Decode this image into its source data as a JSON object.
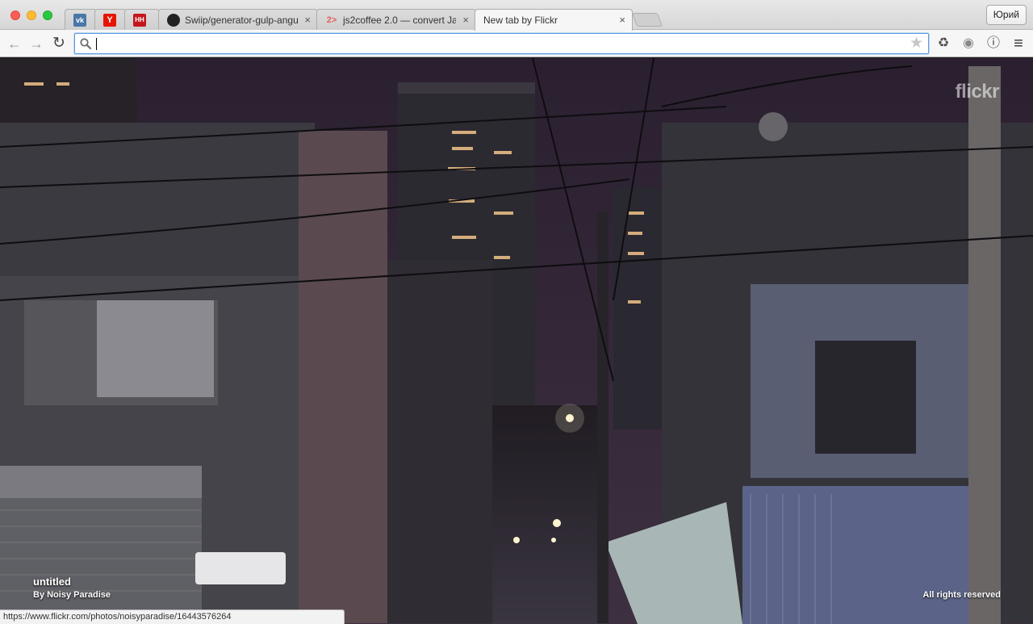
{
  "window": {
    "tabs": [
      {
        "favicon": "vk-icon",
        "favicon_text": "vk",
        "title": ""
      },
      {
        "favicon": "yandex-icon",
        "favicon_text": "Y",
        "title": ""
      },
      {
        "favicon": "habr-icon",
        "favicon_text": "HH",
        "title": ""
      },
      {
        "favicon": "github-icon",
        "favicon_text": "●",
        "title": "Swiip/generator-gulp-angu"
      },
      {
        "favicon": "js2coffee-icon",
        "favicon_text": "2>",
        "title": "js2coffee 2.0 — convert Ja"
      },
      {
        "favicon": "",
        "favicon_text": "",
        "title": "New tab by Flickr",
        "active": true
      }
    ],
    "close_glyph": "×",
    "profile_name": "Юрий"
  },
  "toolbar": {
    "back": "←",
    "forward": "→",
    "reload": "↻",
    "address_value": "",
    "bookmark_star": "★",
    "extensions": [
      {
        "name": "recycle-extension-icon",
        "glyph": "♻"
      },
      {
        "name": "shield-extension-icon",
        "glyph": "◉"
      },
      {
        "name": "info-extension-icon",
        "glyph": "ⓘ"
      }
    ],
    "menu": "≡"
  },
  "page": {
    "logo": "flickr",
    "photo_title": "untitled",
    "photo_author": "By Noisy Paradise",
    "rights": "All rights reserved",
    "status_url": "https://www.flickr.com/photos/noisyparadise/16443576264"
  },
  "colors": {
    "sky_top": "#2b2030",
    "sky_bottom": "#3a2d3d",
    "focus_ring": "#5d9be6"
  }
}
